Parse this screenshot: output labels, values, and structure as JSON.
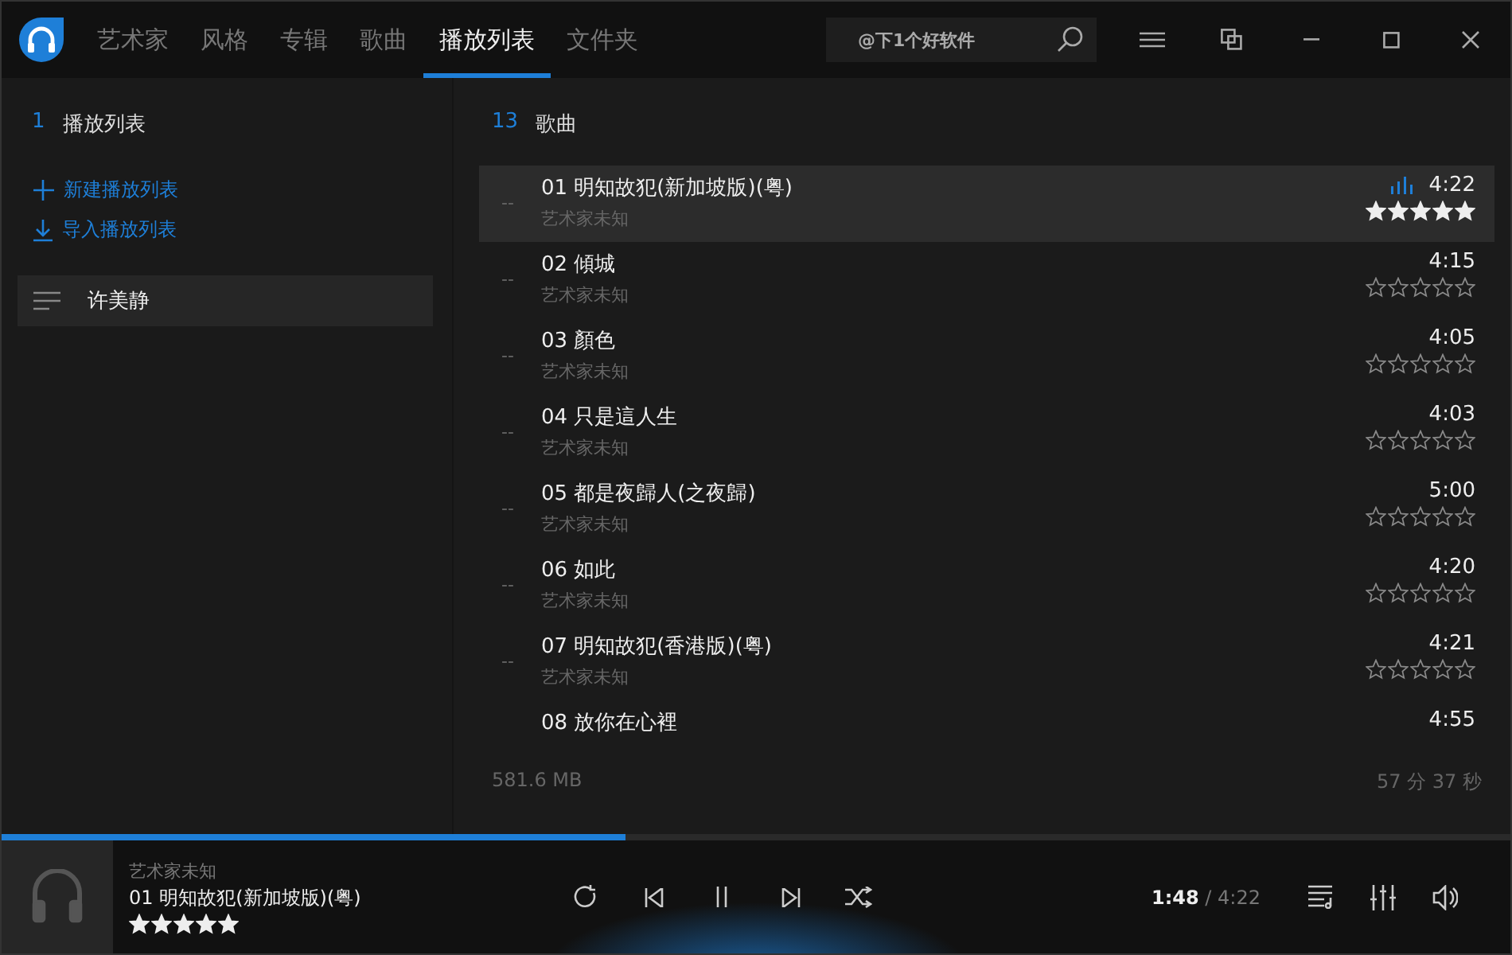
{
  "titlebar": {
    "tabs": [
      {
        "label": "艺术家",
        "selected": false
      },
      {
        "label": "风格",
        "selected": false
      },
      {
        "label": "专辑",
        "selected": false
      },
      {
        "label": "歌曲",
        "selected": false
      },
      {
        "label": "播放列表",
        "selected": true
      },
      {
        "label": "文件夹",
        "selected": false
      }
    ],
    "search": {
      "placeholder": "@下1个好软件"
    }
  },
  "sidebar": {
    "count": "1",
    "title": "播放列表",
    "actions": [
      {
        "kind": "new",
        "label": "新建播放列表"
      },
      {
        "kind": "import",
        "label": "导入播放列表"
      }
    ],
    "playlists": [
      {
        "name": "许美静",
        "selected": true
      }
    ]
  },
  "songs": {
    "count": "13",
    "title": "歌曲",
    "rows": [
      {
        "marker": "--",
        "title": "01 明知故犯(新加坡版)(粤)",
        "artist": "艺术家未知",
        "duration": "4:22",
        "stars": 5,
        "selected": true,
        "playing": true
      },
      {
        "marker": "--",
        "title": "02 傾城",
        "artist": "艺术家未知",
        "duration": "4:15",
        "stars": 0,
        "selected": false,
        "playing": false
      },
      {
        "marker": "--",
        "title": "03 顏色",
        "artist": "艺术家未知",
        "duration": "4:05",
        "stars": 0,
        "selected": false,
        "playing": false
      },
      {
        "marker": "--",
        "title": "04 只是這人生",
        "artist": "艺术家未知",
        "duration": "4:03",
        "stars": 0,
        "selected": false,
        "playing": false
      },
      {
        "marker": "--",
        "title": "05 都是夜歸人(之夜歸)",
        "artist": "艺术家未知",
        "duration": "5:00",
        "stars": 0,
        "selected": false,
        "playing": false
      },
      {
        "marker": "--",
        "title": "06 如此",
        "artist": "艺术家未知",
        "duration": "4:20",
        "stars": 0,
        "selected": false,
        "playing": false
      },
      {
        "marker": "--",
        "title": "07 明知故犯(香港版)(粤)",
        "artist": "艺术家未知",
        "duration": "4:21",
        "stars": 0,
        "selected": false,
        "playing": false
      },
      {
        "title": "08 放你在心裡",
        "duration": "4:55",
        "selected": false,
        "playing": false
      }
    ],
    "size": "581.6 MB",
    "total_time": "57 分 37 秒"
  },
  "player": {
    "level": 0.414,
    "artist": "艺术家未知",
    "title": "01 明知故犯(新加坡版)(粤)",
    "stars": 5,
    "elapsed": "1:48",
    "separator": "/",
    "total": "4:22",
    "playing": true
  }
}
